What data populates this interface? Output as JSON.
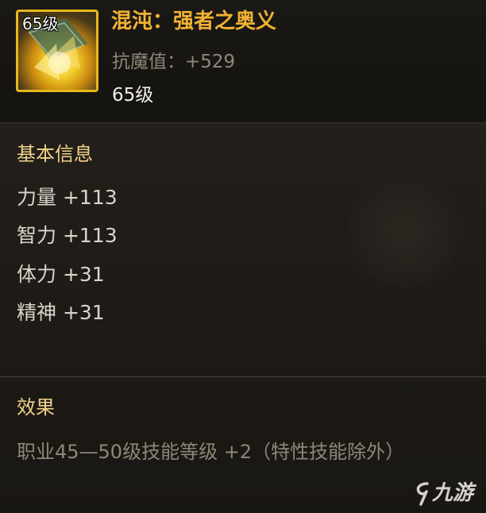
{
  "item": {
    "icon_level": "65级",
    "name": "混沌：强者之奥义",
    "resist_label": "抗魔值：+529",
    "level": "65级"
  },
  "basic_info": {
    "title": "基本信息",
    "stats": [
      "力量 +113",
      "智力 +113",
      "体力 +31",
      "精神 +31"
    ]
  },
  "effect": {
    "title": "效果",
    "text": "职业45—50级技能等级 +2（特性技能除外）"
  },
  "watermark": "九游",
  "colors": {
    "name": "#f2b233",
    "section_title": "#f2d38a",
    "icon_border": "#e8b81c"
  }
}
